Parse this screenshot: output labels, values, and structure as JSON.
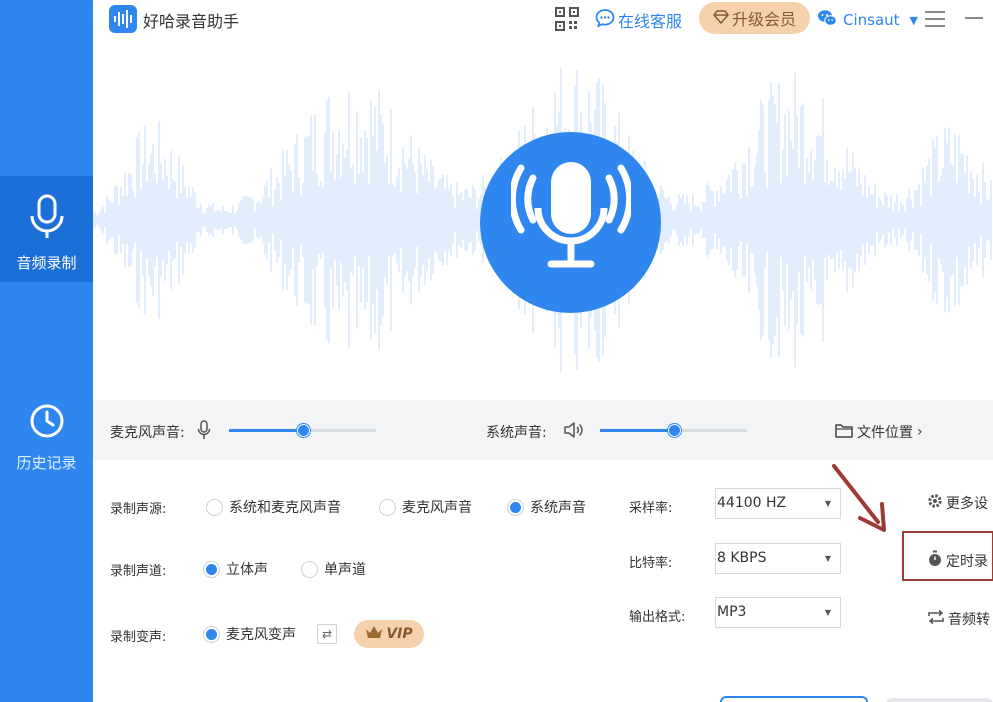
{
  "app": {
    "title": "好哈录音助手"
  },
  "header": {
    "online_service": "在线客服",
    "upgrade": "升级会员",
    "username": "Cinsaut"
  },
  "sidebar": {
    "items": [
      {
        "label": "音频录制",
        "icon": "microphone-icon",
        "active": true
      },
      {
        "label": "历史记录",
        "icon": "clock-icon",
        "active": false
      }
    ]
  },
  "volume": {
    "mic_label": "麦克风声音:",
    "mic_level": 0.5,
    "system_label": "系统声音:",
    "system_level": 0.5,
    "file_location": "文件位置"
  },
  "settings": {
    "source_label": "录制声源:",
    "source_options": [
      "系统和麦克风声音",
      "麦克风声音",
      "系统声音"
    ],
    "source_selected": 2,
    "channel_label": "录制声道:",
    "channel_options": [
      "立体声",
      "单声道"
    ],
    "channel_selected": 0,
    "voice_label": "录制变声:",
    "voice_option": "麦克风变声",
    "vip_tag": "VIP",
    "sample_rate_label": "采样率:",
    "sample_rate": "44100 HZ",
    "bitrate_label": "比特率:",
    "bitrate": "8 KBPS",
    "format_label": "输出格式:",
    "format": "MP3",
    "more_settings": "更多设",
    "timed_record": "定时录",
    "audio_convert": "音频转"
  },
  "colors": {
    "accent": "#2f86ee",
    "sidebar": "#2f86ee",
    "vip": "#f5d2ac",
    "annotation": "#9d3b33"
  }
}
